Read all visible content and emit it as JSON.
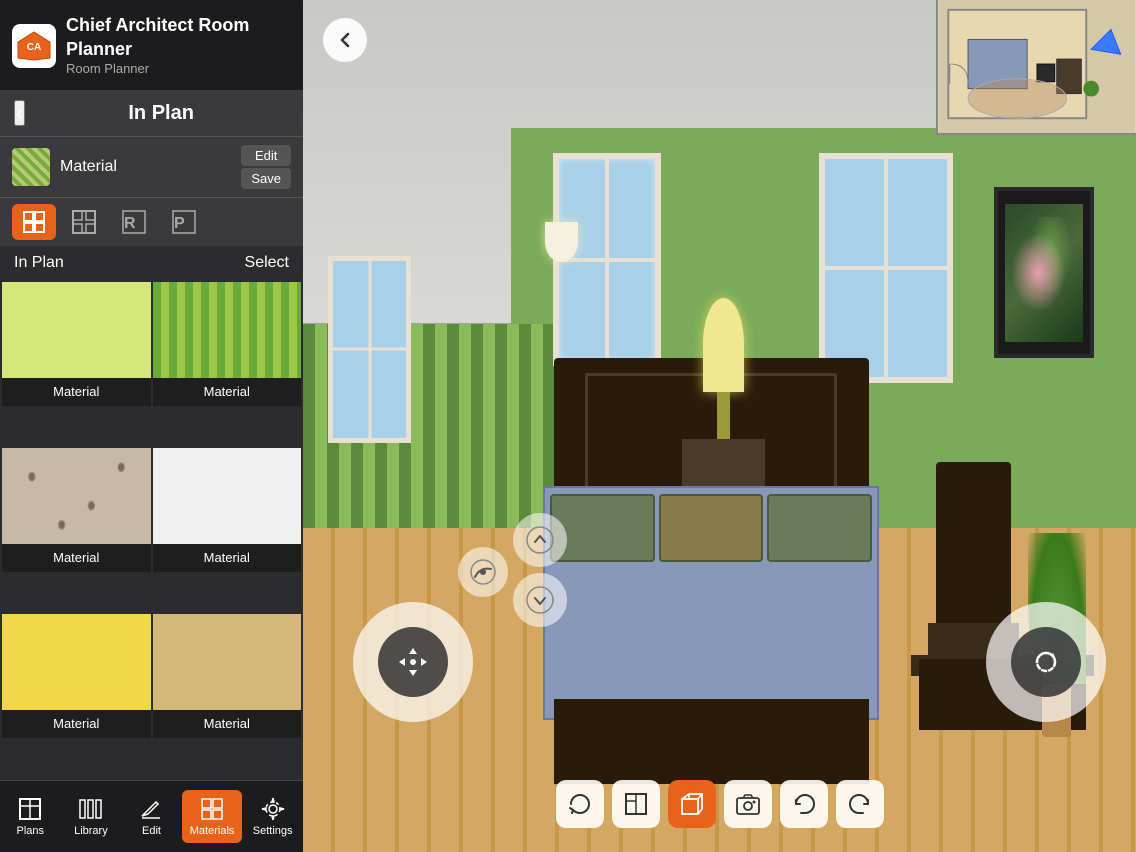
{
  "app": {
    "title": "Chief Architect Room Planner",
    "logo_subtitle": "Room Planner"
  },
  "header": {
    "back_label": "‹",
    "title": "In Plan"
  },
  "material": {
    "label": "Material",
    "edit_btn": "Edit",
    "save_btn": "Save"
  },
  "toolbar": {
    "icons": [
      {
        "name": "active-tool",
        "active": true
      },
      {
        "name": "grid-tool",
        "active": false
      },
      {
        "name": "r-tool",
        "active": false
      },
      {
        "name": "p-tool",
        "active": false
      }
    ]
  },
  "in_plan": {
    "label": "In Plan",
    "select_btn": "Select"
  },
  "materials": [
    {
      "name": "Material",
      "type": "lime-solid"
    },
    {
      "name": "Material",
      "type": "green-stripe"
    },
    {
      "name": "Material",
      "type": "floral"
    },
    {
      "name": "Material",
      "type": "white"
    },
    {
      "name": "Material",
      "type": "yellow"
    },
    {
      "name": "Material",
      "type": "tan"
    }
  ],
  "bottom_nav": [
    {
      "name": "Plans",
      "icon": "plans-icon",
      "active": false
    },
    {
      "name": "Library",
      "icon": "library-icon",
      "active": false
    },
    {
      "name": "Edit",
      "icon": "edit-icon",
      "active": false
    },
    {
      "name": "Materials",
      "icon": "materials-icon",
      "active": true
    },
    {
      "name": "Settings",
      "icon": "settings-icon",
      "active": false
    }
  ],
  "view_toolbar": [
    {
      "name": "refresh",
      "label": "↺",
      "active": false
    },
    {
      "name": "floor-plan",
      "label": "⬜",
      "active": false
    },
    {
      "name": "view-3d-box",
      "label": "⬛",
      "active": true
    },
    {
      "name": "camera",
      "label": "📷",
      "active": false
    },
    {
      "name": "undo",
      "label": "↩",
      "active": false
    },
    {
      "name": "redo",
      "label": "↪",
      "active": false
    }
  ],
  "colors": {
    "orange": "#e8621a",
    "sidebar_bg": "#2c2c2e",
    "dark_bg": "#1c1c1e"
  }
}
